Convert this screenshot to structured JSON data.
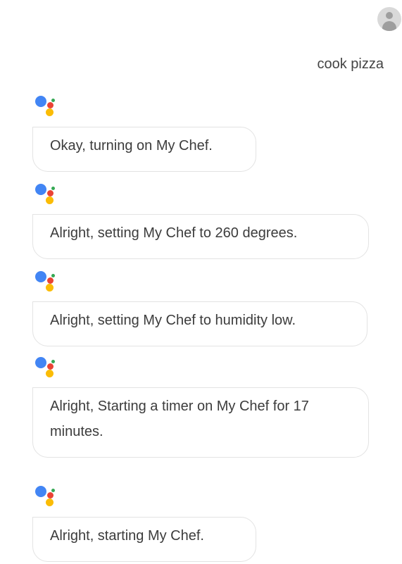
{
  "user": {
    "avatar_icon": "account-icon",
    "query": "cook pizza"
  },
  "assistant": {
    "icon": "google-assistant-icon",
    "responses": [
      "Okay, turning on My Chef.",
      "Alright, setting My Chef to 260 degrees.",
      "Alright, setting My Chef to humidity low.",
      "Alright, Starting a timer on My Chef for 17 minutes.",
      "Alright, starting My Chef."
    ]
  },
  "colors": {
    "blue": "#4285f4",
    "red": "#ea4335",
    "yellow": "#fbbc05",
    "green": "#34a853"
  }
}
